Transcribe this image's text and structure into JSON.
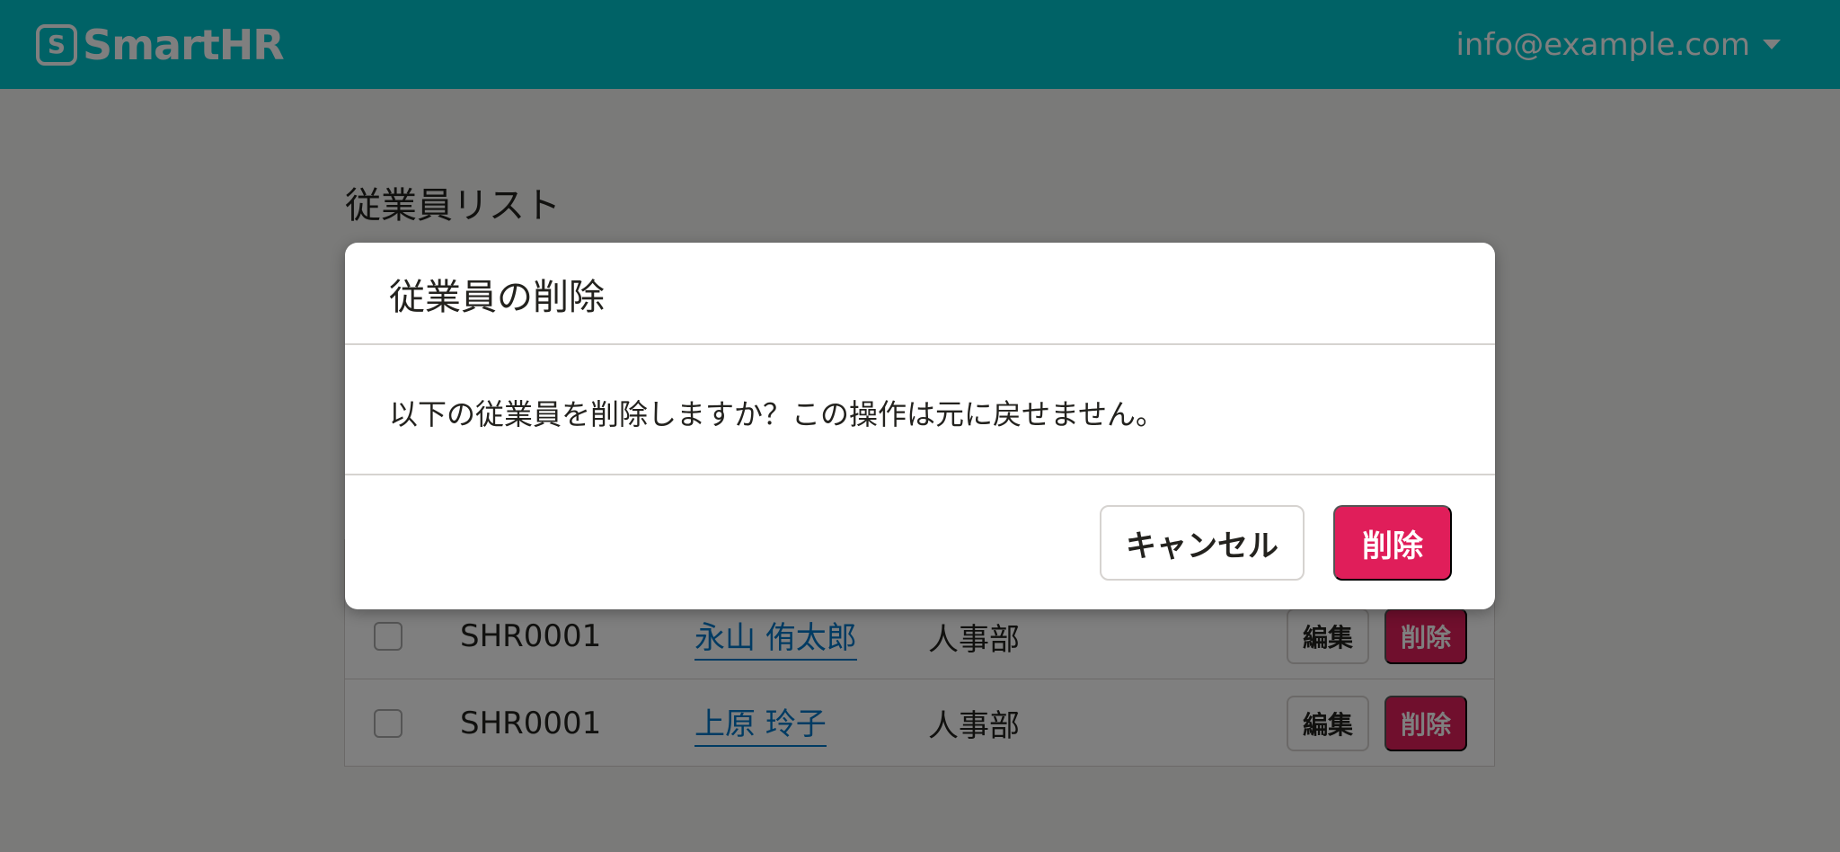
{
  "header": {
    "logo_mark": "S",
    "logo_text": "SmartHR",
    "account_email": "info@example.com"
  },
  "page": {
    "title": "従業員リスト"
  },
  "table": {
    "rows": [
      {
        "id": "SHR0001",
        "name": "永山 侑太郎",
        "dept": "人事部",
        "edit_label": "編集",
        "delete_label": "削除"
      },
      {
        "id": "SHR0001",
        "name": "上原 玲子",
        "dept": "人事部",
        "edit_label": "編集",
        "delete_label": "削除"
      }
    ]
  },
  "dialog": {
    "title": "従業員の削除",
    "message": "以下の従業員を削除しますか？この操作は元に戻せません。",
    "cancel_label": "キャンセル",
    "delete_label": "削除"
  },
  "colors": {
    "header_bg": "#00c4cc",
    "danger": "#e01e5a",
    "link": "#0077c7"
  }
}
